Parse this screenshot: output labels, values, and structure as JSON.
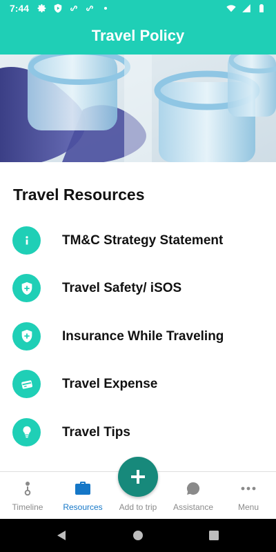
{
  "status_bar": {
    "time": "7:44",
    "left_icons": [
      "settings-icon",
      "shield-play-icon",
      "link-icon",
      "link-icon",
      "dot-icon"
    ],
    "right_icons": [
      "wifi-icon",
      "signal-icon",
      "battery-icon"
    ]
  },
  "app_bar": {
    "title": "Travel Policy"
  },
  "hero": {
    "image": "lab-vials-photo"
  },
  "resources": {
    "title": "Travel Resources",
    "items": [
      {
        "label": "TM&C Strategy Statement",
        "icon": "info-icon"
      },
      {
        "label": "Travel Safety/ iSOS",
        "icon": "shield-plus-icon"
      },
      {
        "label": "Insurance While Traveling",
        "icon": "shield-plus-icon"
      },
      {
        "label": "Travel Expense",
        "icon": "card-icon"
      },
      {
        "label": "Travel Tips",
        "icon": "lightbulb-icon"
      }
    ]
  },
  "bottom_nav": {
    "items": [
      {
        "label": "Timeline",
        "icon": "timeline-icon"
      },
      {
        "label": "Resources",
        "icon": "briefcase-icon",
        "active": true
      },
      {
        "label": "Add to trip",
        "icon": "plus-icon"
      },
      {
        "label": "Assistance",
        "icon": "chat-icon"
      },
      {
        "label": "Menu",
        "icon": "more-icon"
      }
    ]
  },
  "colors": {
    "primary": "#1fcfb6",
    "fab": "#17897b",
    "active_nav": "#1577c7",
    "inactive_nav": "#8a8a8a"
  }
}
